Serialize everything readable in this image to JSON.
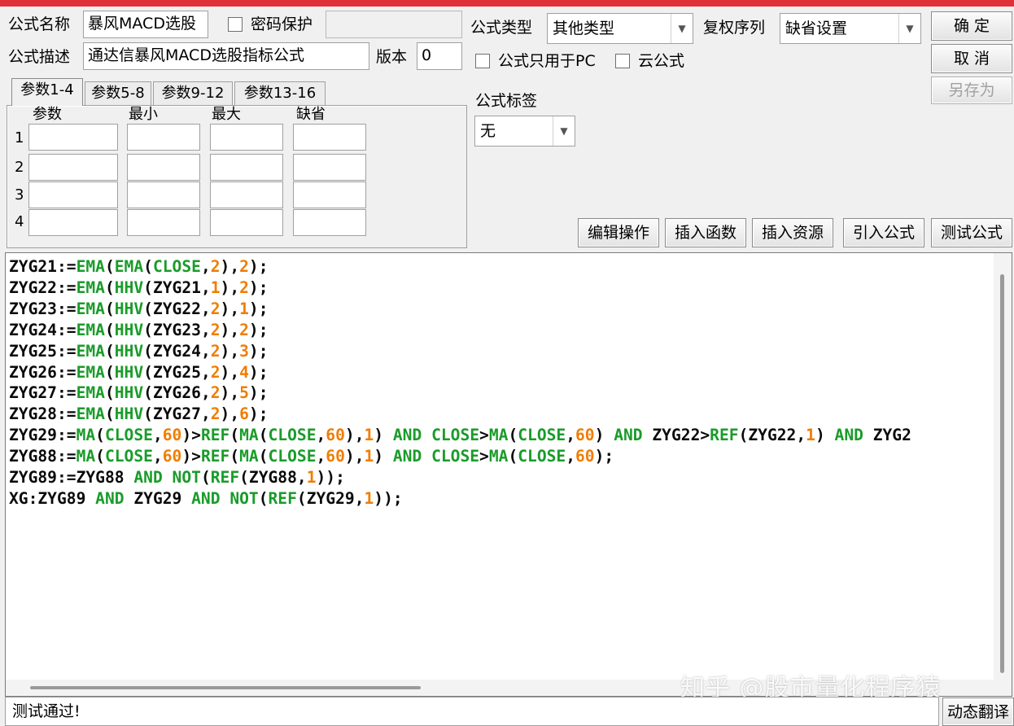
{
  "form": {
    "name_label": "公式名称",
    "name_value": "暴风MACD选股",
    "password_label": "密码保护",
    "desc_label": "公式描述",
    "desc_value": "通达信暴风MACD选股指标公式",
    "version_label": "版本",
    "version_value": "0",
    "type_label": "公式类型",
    "type_value": "其他类型",
    "rights_label": "复权序列",
    "rights_value": "缺省设置",
    "pc_only_label": "公式只用于PC",
    "cloud_label": "云公式",
    "tag_label": "公式标签",
    "tag_value": "无"
  },
  "buttons": {
    "ok": "确  定",
    "cancel": "取  消",
    "save_as": "另存为",
    "edit_ops": "编辑操作",
    "insert_func": "插入函数",
    "insert_res": "插入资源",
    "import_formula": "引入公式",
    "test_formula": "测试公式",
    "dyn_translate": "动态翻译"
  },
  "params": {
    "tabs": [
      "参数1-4",
      "参数5-8",
      "参数9-12",
      "参数13-16"
    ],
    "headers": [
      "参数",
      "最小",
      "最大",
      "缺省"
    ],
    "rows": [
      "1",
      "2",
      "3",
      "4"
    ]
  },
  "code_lines": [
    "ZYG21:=EMA(EMA(CLOSE,2),2);",
    "ZYG22:=EMA(HHV(ZYG21,1),2);",
    "ZYG23:=EMA(HHV(ZYG22,2),1);",
    "ZYG24:=EMA(HHV(ZYG23,2),2);",
    "ZYG25:=EMA(HHV(ZYG24,2),3);",
    "ZYG26:=EMA(HHV(ZYG25,2),4);",
    "ZYG27:=EMA(HHV(ZYG26,2),5);",
    "ZYG28:=EMA(HHV(ZYG27,2),6);",
    "ZYG29:=MA(CLOSE,60)>REF(MA(CLOSE,60),1) AND CLOSE>MA(CLOSE,60) AND ZYG22>REF(ZYG22,1) AND ZYG2",
    "ZYG88:=MA(CLOSE,60)>REF(MA(CLOSE,60),1) AND CLOSE>MA(CLOSE,60);",
    "ZYG89:=ZYG88 AND NOT(REF(ZYG88,1));",
    "XG:ZYG89 AND ZYG29 AND NOT(REF(ZYG29,1));"
  ],
  "status_text": "测试通过!",
  "watermark": "知乎 @股市量化程序猿",
  "colors": {
    "function": "#1a9c2a",
    "number": "#f07d00",
    "title_bar": "#e0313a"
  }
}
